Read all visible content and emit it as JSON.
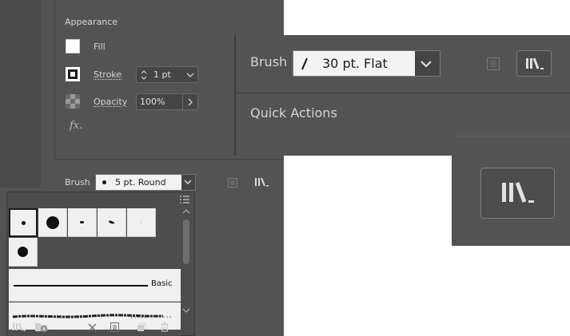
{
  "appearance": {
    "title": "Appearance",
    "fill_label": "Fill",
    "stroke_label": "Stroke",
    "stroke_weight": "1 pt",
    "opacity_label": "Opacity",
    "opacity_value": "100%",
    "fx_label": "fx."
  },
  "brush_bar": {
    "label": "Brush",
    "value": "5 pt. Round"
  },
  "brush_popup": {
    "basic_label": "Basic"
  },
  "zoom_brush": {
    "label": "Brush",
    "value": "30 pt. Flat",
    "quick_actions": "Quick Actions"
  },
  "icons": [
    "chevron-down-icon",
    "menu-lines-icon",
    "libraries-icon",
    "folder-cloud-icon",
    "delete-stroke-icon",
    "options-icon",
    "new-brush-icon",
    "trash-icon",
    "scroll-up-icon",
    "scroll-down-icon",
    "flat-brush-icon",
    "brush-dot-icon"
  ],
  "colors": {
    "panel": "#535353",
    "text": "#d6d6d6",
    "swatch": "#f0f0f0"
  }
}
